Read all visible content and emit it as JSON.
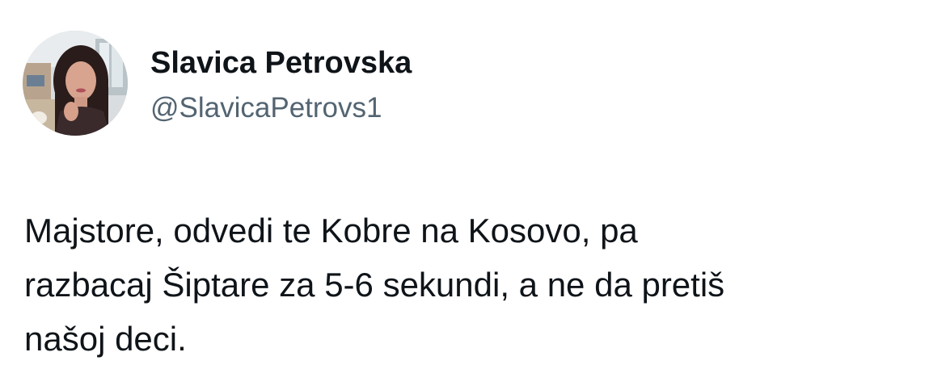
{
  "tweet": {
    "author": {
      "display_name": "Slavica Petrovska",
      "handle": "@SlavicaPetrovs1",
      "avatar_icon": "profile-photo"
    },
    "text": "Majstore, odvedi te Kobre na Kosovo, pa\nrazbacaj Šiptare za 5-6 sekundi, a ne da pretiš\nnašoj deci."
  },
  "colors": {
    "text_primary": "#0f1419",
    "text_secondary": "#536471",
    "background": "#ffffff"
  }
}
